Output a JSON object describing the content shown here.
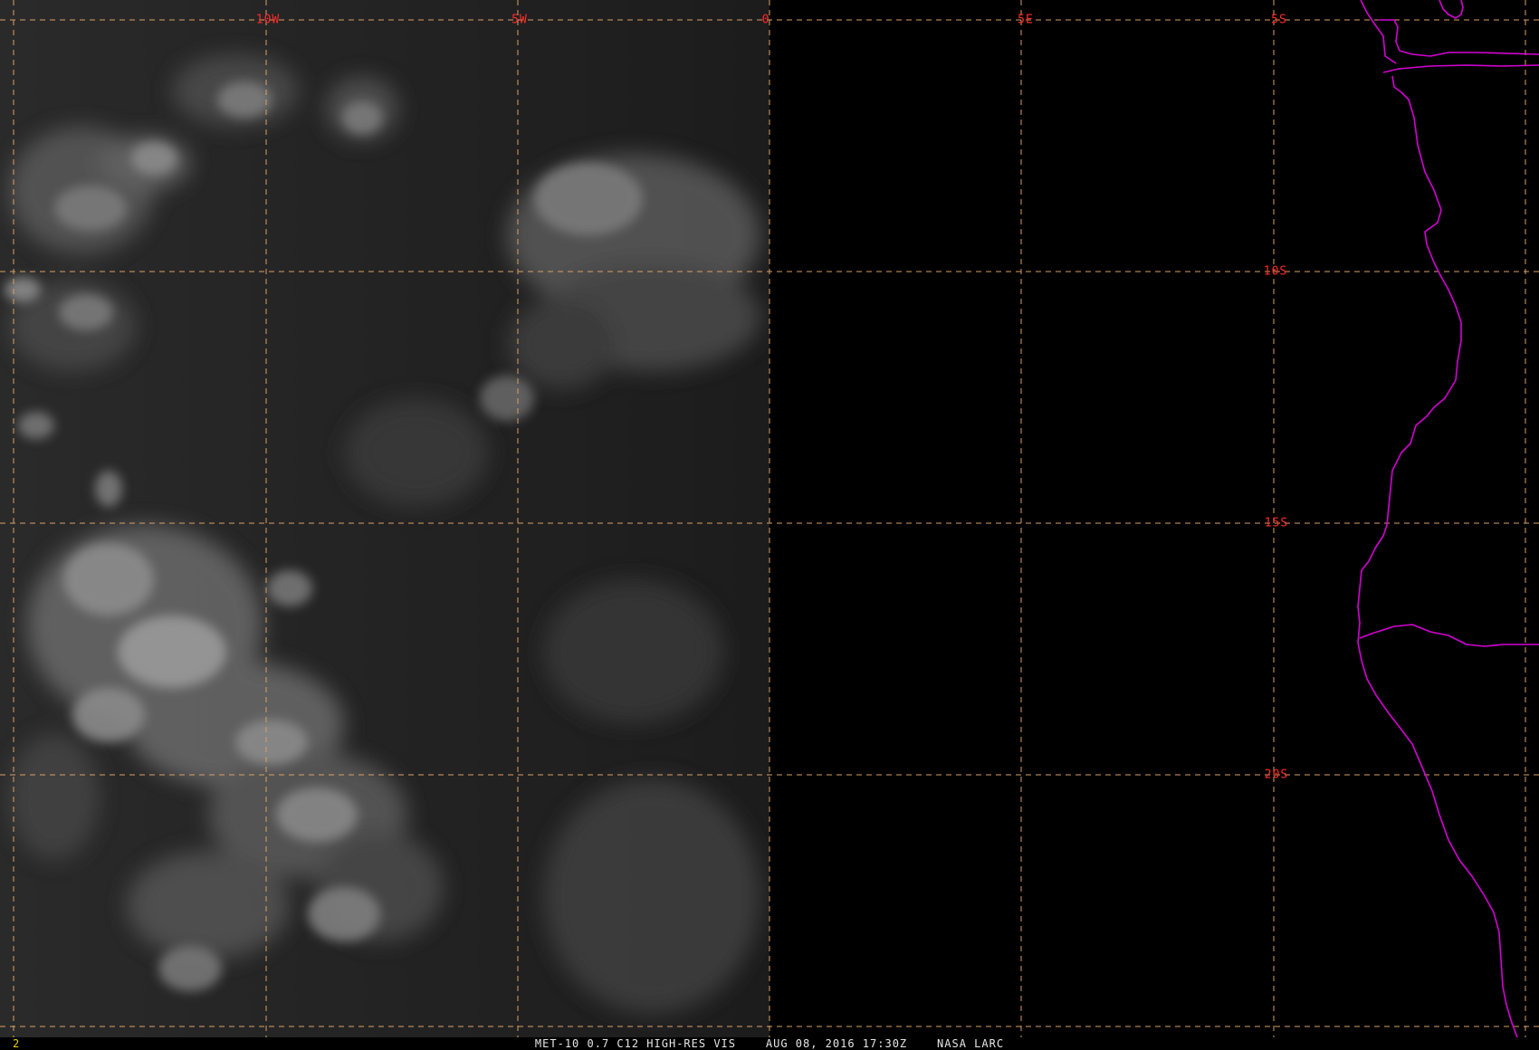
{
  "image": {
    "lon_labels": [
      "10W",
      "5W",
      "0",
      "5E"
    ],
    "lat_labels": [
      "5S",
      "10S",
      "15S",
      "20S"
    ]
  },
  "colors": {
    "grid_line": "#d9a066",
    "grid_label": "#ff2a2a",
    "coastline": "#d400d4",
    "frame_number": "#e8d000",
    "caption": "#e6e6e6"
  },
  "status": {
    "frame_number": "2",
    "caption": "MET-10 0.7 C12 HIGH-RES VIS    AUG 08, 2016 17:30Z    NASA LARC"
  }
}
